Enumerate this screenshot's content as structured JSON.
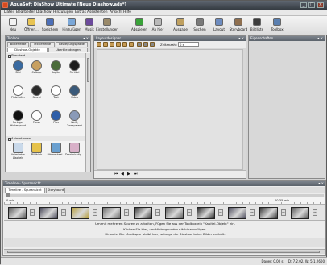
{
  "window": {
    "title": "AquaSoft DiaShow Ultimate [Neue Diashow.ads*]"
  },
  "menu": [
    "Datei",
    "Bearbeiten",
    "Diashow",
    "Hinzufügen",
    "Extras",
    "Assistenten",
    "Ansicht",
    "Hilfe"
  ],
  "toolbar": [
    {
      "label": "Neu",
      "icon": "new-file-icon",
      "color": "#f2f2f2"
    },
    {
      "label": "Öffnen...",
      "icon": "open-folder-icon",
      "color": "#e8c453"
    },
    {
      "label": "Speichern",
      "icon": "save-disk-icon",
      "color": "#4c6fb8"
    },
    {
      "label": "Hinzufügen",
      "icon": "add-image-icon",
      "color": "#7aa7d8"
    },
    {
      "label": "Musik",
      "icon": "music-note-icon",
      "color": "#6c4a9c"
    },
    {
      "label": "Einstellungen",
      "icon": "settings-icon",
      "color": "#9a8a6a"
    },
    {
      "label": "Abspielen",
      "icon": "play-icon",
      "color": "#39a339"
    },
    {
      "label": "Ab hier",
      "icon": "play-from-here-icon",
      "color": "#b9b9b9"
    },
    {
      "label": "Ausgabe",
      "icon": "output-icon",
      "color": "#bfa060"
    },
    {
      "label": "Suchen",
      "icon": "search-icon",
      "color": "#7a7a7a"
    },
    {
      "label": "Layout",
      "icon": "layout-icon",
      "color": "#6d8cc0"
    },
    {
      "label": "Storyboard",
      "icon": "storyboard-icon",
      "color": "#8f6f4f"
    },
    {
      "label": "Bildliste",
      "icon": "image-list-icon",
      "color": "#3c3c3c"
    },
    {
      "label": "Toolbox",
      "icon": "toolbox-icon",
      "color": "#5a7fb0"
    }
  ],
  "left_panel": {
    "header": "Toolbox",
    "tabs_top": [
      "Bildeffekte",
      "Textieffekte",
      "Bewegungspfade"
    ],
    "tabs_bottom": [
      "Diashow-Objekte",
      "Überblendungen"
    ],
    "section_standard": "Standard",
    "section_animationen": "Animationen",
    "objects": [
      {
        "label": "Bild",
        "color": "#3a6aa0"
      },
      {
        "label": "Collage",
        "color": "#c8a060"
      },
      {
        "label": "Kapitel",
        "color": "#4a6b3a"
      },
      {
        "label": "Partikel",
        "color": "#1c1c1c"
      },
      {
        "label": "Platzhalter",
        "color": "#ffffff"
      },
      {
        "label": "Sound",
        "color": "#2a2a2a"
      },
      {
        "label": "Text",
        "color": "#ffffff"
      },
      {
        "label": "Video",
        "color": "#3a5a7a"
      },
      {
        "label": "Farbiger Hintergrund",
        "color": "#111111"
      },
      {
        "label": "Pause",
        "color": "#ffffff"
      },
      {
        "label": "Plus",
        "color": "#2f5fa8"
      },
      {
        "label": "Weiß, Transparent",
        "color": "#8a9ab8"
      }
    ],
    "animations": [
      {
        "label": "Animiertes Wackeln",
        "color": "#c9d9ea"
      },
      {
        "label": "Bildblick",
        "color": "#e6c24a"
      },
      {
        "label": "Bildwechsel...",
        "color": "#6aa0d0"
      },
      {
        "label": "Durchsichtig...",
        "color": "#d8b0c8"
      }
    ]
  },
  "center_panel": {
    "header": "Layoutdesigner",
    "zoom_label": "Zeitanzahl:",
    "zoom_value": "0 s"
  },
  "right_panel": {
    "header": "Eigenschaften"
  },
  "bottom_panel": {
    "header": "Timeline - Spuransicht",
    "tabs": [
      "Timeline - Spuransicht",
      "Storyboard"
    ],
    "ruler": [
      "0 min",
      "00:35 min"
    ],
    "thumbnails": [
      {
        "color": "#5a5a5a"
      },
      {
        "color": "#4a4a5a"
      },
      {
        "color": "#b8a040"
      },
      {
        "color": "#707070"
      },
      {
        "color": "#3a3a3a"
      },
      {
        "color": "#606060"
      },
      {
        "color": "#2a2a2a"
      },
      {
        "color": "#505060"
      },
      {
        "color": "#3a3a3a"
      },
      {
        "color": "#5a5a5a"
      }
    ],
    "info_line1": "Um mit mehreren Spuren zu arbeiten, Fügen Sie aus der Toolbox ein \"Kapitel-Objekt\" ein.",
    "info_line2": "Klicken Sie hier, um Hintergrundmusik hinzuzufügen.",
    "info_line3": "Hinweis: Die Musikspur bleibt leer, solange die Diashow keine Bilder enthält."
  },
  "status": {
    "text": "Dauer: 0,00 s     D: 7.2.02, W: 5.1.2600"
  }
}
